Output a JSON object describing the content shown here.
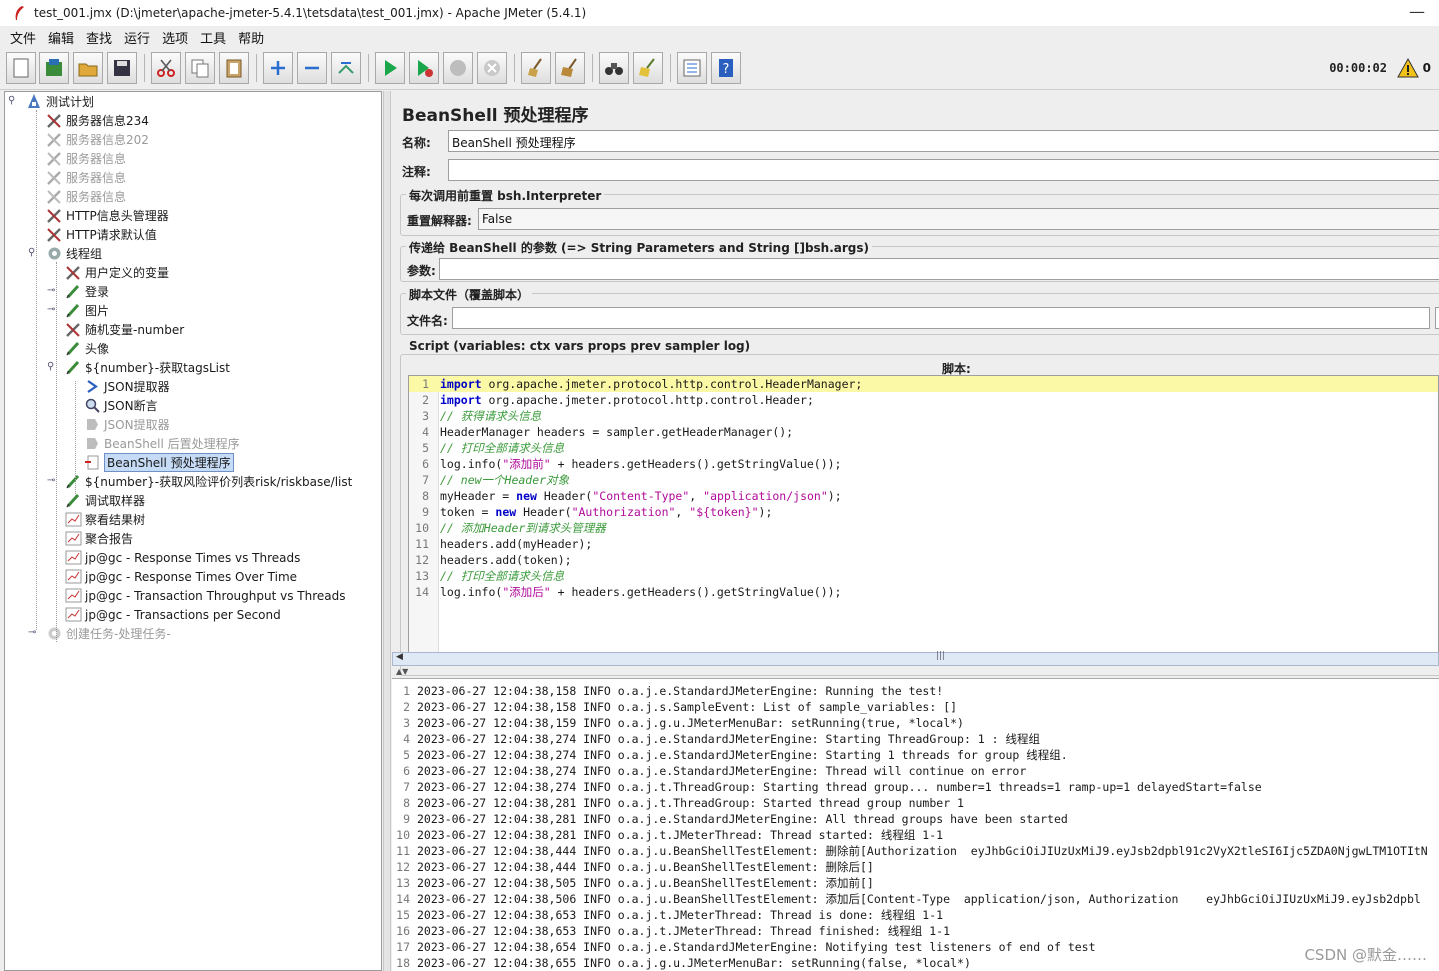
{
  "window": {
    "title": "test_001.jmx (D:\\jmeter\\apache-jmeter-5.4.1\\tetsdata\\test_001.jmx) - Apache JMeter (5.4.1)"
  },
  "menu": [
    "文件",
    "编辑",
    "查找",
    "运行",
    "选项",
    "工具",
    "帮助"
  ],
  "toolbar": {
    "timer": "00:00:02",
    "warnings": "0"
  },
  "tree": {
    "root": "测试计划",
    "items": [
      {
        "label": "服务器信息234",
        "enabled": true
      },
      {
        "label": "服务器信息202",
        "enabled": false
      },
      {
        "label": "服务器信息",
        "enabled": false
      },
      {
        "label": "服务器信息",
        "enabled": false
      },
      {
        "label": "服务器信息",
        "enabled": false
      },
      {
        "label": "HTTP信息头管理器",
        "enabled": true
      },
      {
        "label": "HTTP请求默认值",
        "enabled": true
      },
      {
        "label": "线程组",
        "enabled": true
      },
      {
        "label": "用户定义的变量",
        "enabled": true
      },
      {
        "label": "登录",
        "enabled": true
      },
      {
        "label": "图片",
        "enabled": true
      },
      {
        "label": "随机变量-number",
        "enabled": true
      },
      {
        "label": "头像",
        "enabled": true
      },
      {
        "label": "${number}-获取tagsList",
        "enabled": true
      },
      {
        "label": "JSON提取器",
        "enabled": true
      },
      {
        "label": "JSON断言",
        "enabled": true
      },
      {
        "label": "JSON提取器",
        "enabled": false
      },
      {
        "label": "BeanShell 后置处理程序",
        "enabled": false
      },
      {
        "label": "BeanShell 预处理程序",
        "enabled": true,
        "selected": true
      },
      {
        "label": "${number}-获取风险评价列表risk/riskbase/list",
        "enabled": true
      },
      {
        "label": "调试取样器",
        "enabled": true
      },
      {
        "label": "察看结果树",
        "enabled": true
      },
      {
        "label": "聚合报告",
        "enabled": true
      },
      {
        "label": "jp@gc - Response Times vs Threads",
        "enabled": true
      },
      {
        "label": "jp@gc - Response Times Over Time",
        "enabled": true
      },
      {
        "label": "jp@gc - Transaction Throughput vs Threads",
        "enabled": true
      },
      {
        "label": "jp@gc - Transactions per Second",
        "enabled": true
      },
      {
        "label": "创建任务-处理任务-",
        "enabled": false
      }
    ]
  },
  "panel": {
    "title": "BeanShell 预处理程序",
    "name_label": "名称:",
    "name_value": "BeanShell 预处理程序",
    "comment_label": "注释:",
    "comment_value": "",
    "reset_group": "每次调用前重置 bsh.Interpreter",
    "reset_label": "重置解释器:",
    "reset_value": "False",
    "params_group": "传递给 BeanShell 的参数 (=> String Parameters and String []bsh.args)",
    "params_label": "参数:",
    "params_value": "",
    "file_group": "脚本文件（覆盖脚本）",
    "file_label": "文件名:",
    "file_value": "",
    "script_group": "Script (variables: ctx vars props prev sampler log)",
    "script_label": "脚本:"
  },
  "script_lines": [
    "import org.apache.jmeter.protocol.http.control.HeaderManager;",
    "import org.apache.jmeter.protocol.http.control.Header;",
    "// 获得请求头信息",
    "HeaderManager headers = sampler.getHeaderManager();",
    "// 打印全部请求头信息",
    "log.info(\"添加前\" + headers.getHeaders().getStringValue());",
    "// new一个Header对象",
    "myHeader = new Header(\"Content-Type\", \"application/json\");",
    "token = new Header(\"Authorization\", \"${token}\");",
    "// 添加Header到请求头管理器",
    "headers.add(myHeader);",
    "headers.add(token);",
    "// 打印全部请求头信息",
    "log.info(\"添加后\" + headers.getHeaders().getStringValue());"
  ],
  "log_lines": [
    "2023-06-27 12:04:38,158 INFO o.a.j.e.StandardJMeterEngine: Running the test!",
    "2023-06-27 12:04:38,158 INFO o.a.j.s.SampleEvent: List of sample_variables: []",
    "2023-06-27 12:04:38,159 INFO o.a.j.g.u.JMeterMenuBar: setRunning(true, *local*)",
    "2023-06-27 12:04:38,274 INFO o.a.j.e.StandardJMeterEngine: Starting ThreadGroup: 1 : 线程组",
    "2023-06-27 12:04:38,274 INFO o.a.j.e.StandardJMeterEngine: Starting 1 threads for group 线程组.",
    "2023-06-27 12:04:38,274 INFO o.a.j.e.StandardJMeterEngine: Thread will continue on error",
    "2023-06-27 12:04:38,274 INFO o.a.j.t.ThreadGroup: Starting thread group... number=1 threads=1 ramp-up=1 delayedStart=false",
    "2023-06-27 12:04:38,281 INFO o.a.j.t.ThreadGroup: Started thread group number 1",
    "2023-06-27 12:04:38,281 INFO o.a.j.e.StandardJMeterEngine: All thread groups have been started",
    "2023-06-27 12:04:38,281 INFO o.a.j.t.JMeterThread: Thread started: 线程组 1-1",
    "2023-06-27 12:04:38,444 INFO o.a.j.u.BeanShellTestElement: 删除前[Authorization  eyJhbGciOiJIUzUxMiJ9.eyJsb2dpbl91c2VyX2tleSI6Ijc5ZDA0NjgwLTM1OTItN",
    "2023-06-27 12:04:38,444 INFO o.a.j.u.BeanShellTestElement: 删除后[]",
    "2023-06-27 12:04:38,505 INFO o.a.j.u.BeanShellTestElement: 添加前[]",
    "2023-06-27 12:04:38,506 INFO o.a.j.u.BeanShellTestElement: 添加后[Content-Type  application/json, Authorization    eyJhbGciOiJIUzUxMiJ9.eyJsb2dpbl",
    "2023-06-27 12:04:38,653 INFO o.a.j.t.JMeterThread: Thread is done: 线程组 1-1",
    "2023-06-27 12:04:38,653 INFO o.a.j.t.JMeterThread: Thread finished: 线程组 1-1",
    "2023-06-27 12:04:38,654 INFO o.a.j.e.StandardJMeterEngine: Notifying test listeners of end of test",
    "2023-06-27 12:04:38,655 INFO o.a.j.g.u.JMeterMenuBar: setRunning(false, *local*)"
  ],
  "watermark": "CSDN @默金……"
}
